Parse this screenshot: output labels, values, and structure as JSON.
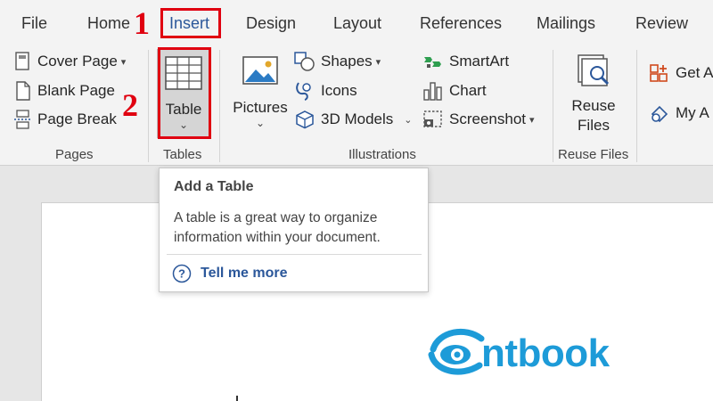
{
  "menu": {
    "tabs": [
      "File",
      "Home",
      "Insert",
      "Design",
      "Layout",
      "References",
      "Mailings",
      "Review"
    ],
    "active": "Insert"
  },
  "ribbon": {
    "pages": {
      "group_label": "Pages",
      "cover_page": "Cover Page",
      "blank_page": "Blank Page",
      "page_break": "Page Break"
    },
    "tables": {
      "group_label": "Tables",
      "table": "Table"
    },
    "illustrations": {
      "group_label": "Illustrations",
      "pictures": "Pictures",
      "shapes": "Shapes",
      "icons": "Icons",
      "models_3d": "3D Models",
      "smartart": "SmartArt",
      "chart": "Chart",
      "screenshot": "Screenshot"
    },
    "reuse_files": {
      "group_label": "Reuse Files",
      "line1": "Reuse",
      "line2": "Files"
    },
    "addins": {
      "get_addins": "Get A",
      "my_addins": "My A"
    }
  },
  "annotations": {
    "step1": "1",
    "step2": "2"
  },
  "tooltip": {
    "title": "Add a Table",
    "description": "A table is a great way to organize information within your document.",
    "help_link": "Tell me more"
  },
  "watermark": {
    "text": "ntbook"
  },
  "colors": {
    "accent": "#2b579a",
    "annotation": "#e00010",
    "logo": "#1d9bd8"
  }
}
